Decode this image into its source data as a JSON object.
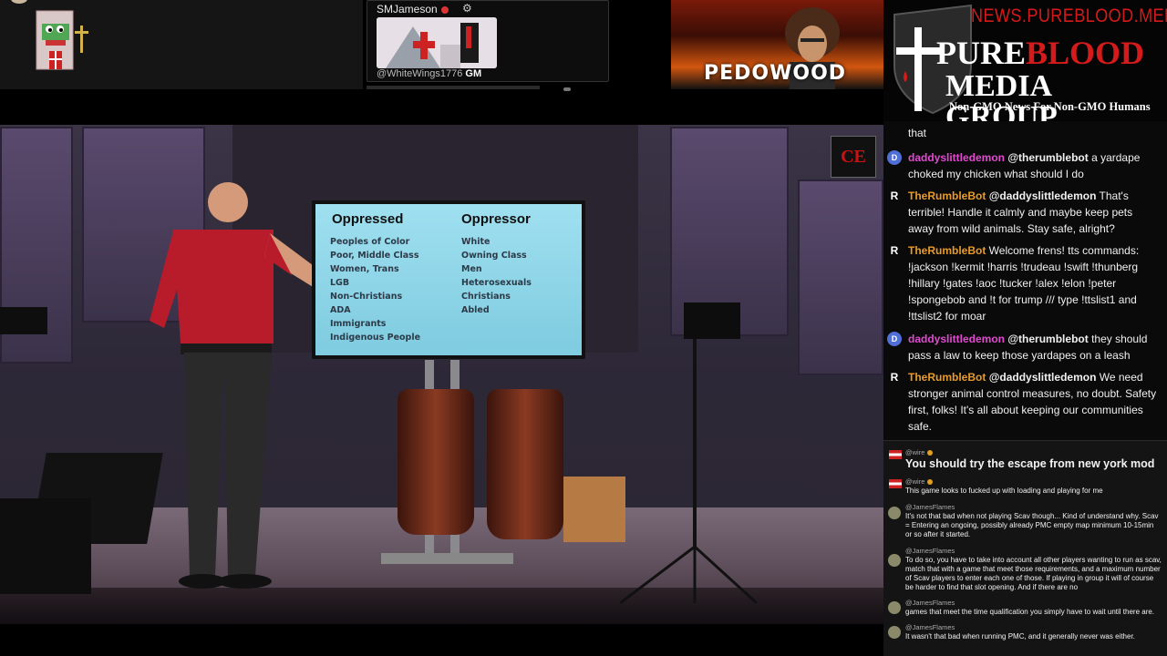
{
  "top_card": {
    "name": "SMJameson",
    "handle": "@WhiteWings1776",
    "handle_suffix": "GM"
  },
  "banner": {
    "text": "PEDOWOOD"
  },
  "logo": {
    "url": "NEWS.PUREBLOOD.MEDIA",
    "line1_initial": "P",
    "line1_rest_white": "URE",
    "line1_red": "BLOOD",
    "line2": "MEDIA GROUP",
    "tagline": "Non-GMO News For Non-GMO Humans"
  },
  "video": {
    "camera_logo": "CE",
    "slide": {
      "left_heading": "Oppressed",
      "right_heading": "Oppressor",
      "left_items": [
        "Peoples of Color",
        "Poor, Middle Class",
        "Women, Trans",
        "LGB",
        "Non-Christians",
        "ADA",
        "Immigrants",
        "Indigenous People"
      ],
      "right_items": [
        "White",
        "Owning Class",
        "Men",
        "Heterosexuals",
        "Christians",
        "Abled"
      ]
    }
  },
  "chat": {
    "messages": [
      {
        "avatar": "",
        "user": "",
        "mention": "",
        "text": "that",
        "user_color": "pink"
      },
      {
        "avatar": "D",
        "user": "daddyslittledemon",
        "mention": "@therumblebot",
        "text": " a yardape choked my chicken what should I do",
        "user_color": "pink"
      },
      {
        "avatar": "R",
        "user": "TheRumbleBot",
        "mention": "@daddyslittledemon",
        "text": " That's terrible! Handle it calmly and maybe keep pets away from wild animals. Stay safe, alright?",
        "user_color": "orange"
      },
      {
        "avatar": "R",
        "user": "TheRumbleBot",
        "mention": "",
        "text": " Welcome frens! tts commands: !jackson !kermit !harris !trudeau !swift !thunberg !hillary !gates !aoc !tucker !alex !elon !peter !spongebob and !t for trump /// type !ttslist1 and !ttslist2 for moar",
        "user_color": "orange"
      },
      {
        "avatar": "D",
        "user": "daddyslittledemon",
        "mention": "@therumblebot",
        "text": " they should pass a law to keep those yardapes on a leash",
        "user_color": "pink"
      },
      {
        "avatar": "R",
        "user": "TheRumbleBot",
        "mention": "@daddyslittledemon",
        "text": " We need stronger animal control measures, no doubt. Safety first, folks! It's all about keeping our communities safe.",
        "user_color": "orange"
      }
    ]
  },
  "chat2": {
    "messages": [
      {
        "user": "@wire",
        "text": "You should try the escape from new york mod",
        "style": "big"
      },
      {
        "user": "@wire",
        "text": "This game looks to fucked up with loading and playing for me",
        "style": "small"
      },
      {
        "user": "@JamesFlames",
        "text": "It's not that bad when not playing Scav though... Kind of understand why. Scav = Entering an ongoing, possibly already PMC empty map minimum 10-15min or so after it started.",
        "style": "small"
      },
      {
        "user": "@JamesFlames",
        "text": "To do so, you have to take into account all other players wanting to run as scav, match that with a game that meet those requirements, and a maximum number of Scav players to enter each one of those. If playing in group it will of course be harder to find that slot opening. And if there are no",
        "style": "small"
      },
      {
        "user": "@JamesFlames",
        "text": "games that meet the time qualification you simply have to wait until there are.",
        "style": "small"
      },
      {
        "user": "@JamesFlames",
        "text": "It wasn't that bad when running PMC, and it generally never was either.",
        "style": "small"
      }
    ]
  }
}
